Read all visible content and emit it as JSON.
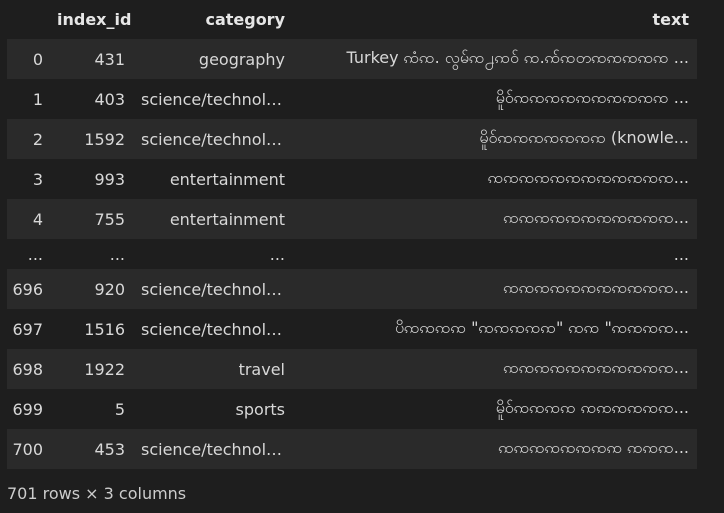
{
  "table": {
    "columns": [
      "",
      "index_id",
      "category",
      "text"
    ],
    "rows": [
      {
        "row_index": "0",
        "index_id": "431",
        "category": "geography",
        "text": "Turkey ꩡံꩡ. လွမ်ꩡ႕ꩡဝ် ꩡ.ꩡ်ꩡတꩡꩡꩡꩡꩡ ..."
      },
      {
        "row_index": "1",
        "index_id": "403",
        "category": "science/technology",
        "text": "မိူဝ်ꩡꩡꩡꩡꩡꩡꩡꩡꩡꩡ ..."
      },
      {
        "row_index": "2",
        "index_id": "1592",
        "category": "science/technology",
        "text": "မိူဝ်ꩡꩡꩡꩡꩡꩡꩡ (knowle..."
      },
      {
        "row_index": "3",
        "index_id": "993",
        "category": "entertainment",
        "text": "ꩡꩡꩡꩡꩡꩡꩡꩡꩡꩡꩡꩡ..."
      },
      {
        "row_index": "4",
        "index_id": "755",
        "category": "entertainment",
        "text": "ꩡꩡꩡꩡꩡꩡꩡꩡꩡꩡꩡ..."
      },
      {
        "row_index": "...",
        "index_id": "...",
        "category": "...",
        "text": "..."
      },
      {
        "row_index": "696",
        "index_id": "920",
        "category": "science/technology",
        "text": "ꩡꩡꩡꩡꩡꩡꩡꩡꩡꩡꩡ..."
      },
      {
        "row_index": "697",
        "index_id": "1516",
        "category": "science/technology",
        "text": "ပိꩡꩡꩡꩡ \"ꩡꩡꩡꩡꩡ\" ꩡꩡ \"ꩡꩡꩡꩡ..."
      },
      {
        "row_index": "698",
        "index_id": "1922",
        "category": "travel",
        "text": "ꩡꩡꩡꩡꩡꩡꩡꩡꩡꩡꩡ..."
      },
      {
        "row_index": "699",
        "index_id": "5",
        "category": "sports",
        "text": "မိူဝ်ꩡꩡꩡꩡ ꩡꩡꩡꩡꩡꩡ..."
      },
      {
        "row_index": "700",
        "index_id": "453",
        "category": "science/technology",
        "text": "ꩡꩡꩡꩡꩡꩡꩡꩡ ꩡꩡꩡ..."
      }
    ]
  },
  "footer": "701 rows × 3 columns"
}
